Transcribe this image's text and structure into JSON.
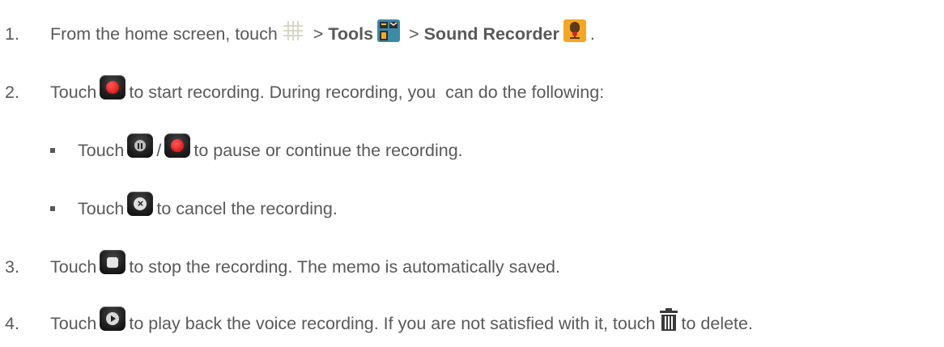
{
  "steps": [
    {
      "num": "1.",
      "before": "From the home screen, touch",
      "sep1": " > ",
      "tools": "Tools",
      "sep2": " > ",
      "recorder": "Sound Recorder",
      "after": "."
    },
    {
      "num": "2.",
      "before": "Touch",
      "after": "to start recording. During recording, you  can do the following:"
    },
    {
      "num": "3.",
      "before": "Touch",
      "after": "to stop the recording. The memo is automatically saved."
    },
    {
      "num": "4.",
      "before": "Touch",
      "middle": "to play back the voice recording. If you are not satisfied with it, touch",
      "after": "to delete."
    }
  ],
  "substeps": [
    {
      "before": "Touch",
      "slash": "/",
      "after": "to pause or continue the recording."
    },
    {
      "before": "Touch",
      "after": "to cancel the recording."
    }
  ],
  "icons": [
    "apps-grid-icon",
    "tools-folder-icon",
    "sound-recorder-app-icon",
    "record-button-icon",
    "pause-button-icon",
    "cancel-button-icon",
    "stop-button-icon",
    "play-button-icon",
    "trash-icon"
  ],
  "colors": {
    "text": "#58595b",
    "record": "#d40000",
    "app_orange": "#f5a623"
  }
}
